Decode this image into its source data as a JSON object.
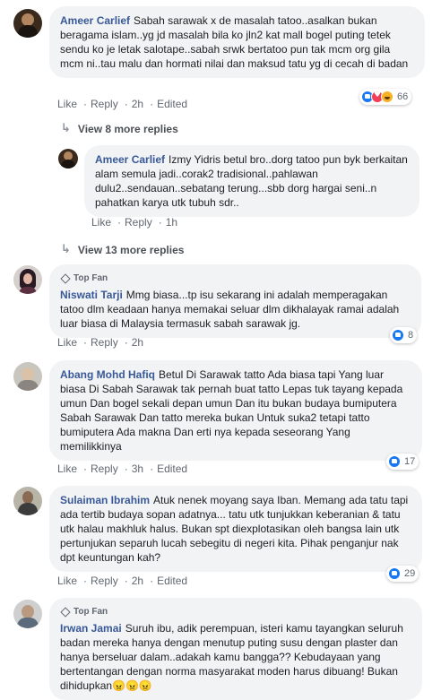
{
  "actions": {
    "like": "Like",
    "reply": "Reply",
    "edited": "Edited"
  },
  "comments": [
    {
      "name": "Ameer Carlief",
      "text": "Sabah sarawak x de masalah tatoo..asalkan bukan beragama islam..yg jd masalah bila ko jln2 kat mall bogel puting tetek sendu ko je letak salotape..sabah srwk bertatoo pun tak mcm org gila mcm ni..tau malu dan hormati nilai dan maksud tatu yg di cecah di badan",
      "time": "2h",
      "edited": true,
      "reactions": [
        "like",
        "love",
        "haha"
      ],
      "reaction_count": "66"
    },
    {
      "name": "Ameer Carlief",
      "text": "Izmy Yidris betul bro..dorg tatoo pun byk berkaitan alam semula jadi..corak2 tradisional..pahlawan dulu2..sendauan..sebatang terung...sbb dorg hargai seni..n pahatkan karya utk tubuh sdr..",
      "time": "1h"
    },
    {
      "badge": "Top Fan",
      "name": "Niswati Tarji",
      "text": "Mmg biasa...tp isu sekarang ini adalah memperagakan tatoo dlm keadaan hanya memakai seluar dlm dikhalayak ramai adalah luar biasa di Malaysia termasuk sabah sarawak jg.",
      "time": "2h",
      "reactions": [
        "like"
      ],
      "reaction_count": "8"
    },
    {
      "name": "Abang Mohd Hafiq",
      "text": "Betul Di Sarawak tatto Ada biasa tapi Yang luar biasa Di Sabah Sarawak tak pernah buat tatto Lepas tuk tayang kepada umun Dan bogel sekali depan umun Dan itu bukan budaya bumiputera Sabah Sarawak Dan tatto mereka bukan Untuk suka2 tetapi tatto bumiputera Ada makna Dan erti nya kepada seseorang Yang memilikkinya",
      "time": "3h",
      "edited": true,
      "reactions": [
        "like"
      ],
      "reaction_count": "17"
    },
    {
      "name": "Sulaiman Ibrahim",
      "text": "Atuk nenek moyang saya Iban. Memang ada tatu tapi ada tertib budaya sopan adatnya... tatu utk tunjukkan keberanian & tatu utk halau makhluk halus. Bukan spt diexplotasikan oleh bangsa lain utk pertunjukan separuh lucah sebegitu di negeri kita. Pihak penganjur nak dpt keuntungan kah?",
      "time": "2h",
      "edited": true,
      "reactions": [
        "like"
      ],
      "reaction_count": "29"
    },
    {
      "badge": "Top Fan",
      "name": "Irwan Jamai",
      "text": "Suruh ibu, adik perempuan, isteri kamu tayangkan seluruh badan mereka hanya dengan menutup puting susu dengan plaster dan hanya berseluar dalam..adakah kamu bangga?? Kebudayaan yang bertentangan dengan norma masyarakat moden harus dibuang! Bukan dihidupkan😠😠😠"
    }
  ],
  "view_more": [
    "View 8 more replies",
    "View 13 more replies"
  ]
}
